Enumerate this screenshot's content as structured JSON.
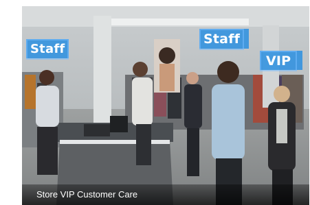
{
  "card": {
    "caption": "Store VIP Customer Care",
    "labels": {
      "staff_left": "Staff",
      "staff_right": "Staff",
      "vip": "VIP"
    }
  },
  "colors": {
    "label_bg": "#2b8fe0",
    "caption_bg": "#000000"
  }
}
